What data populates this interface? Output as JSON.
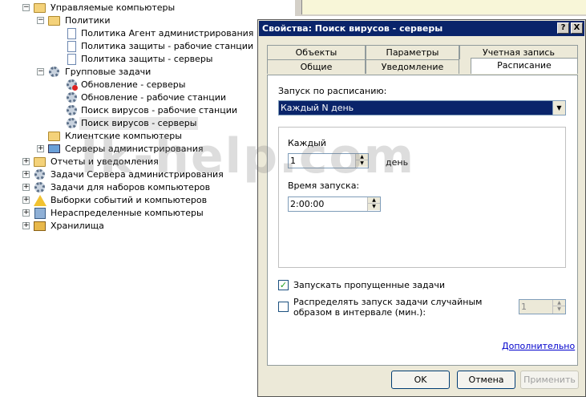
{
  "tree": {
    "managed_computers": "Управляемые компьютеры",
    "policies": "Политики",
    "policy_agent": "Политика Агент администрирования",
    "policy_workstations": "Политика защиты - рабочие станции",
    "policy_servers": "Политика защиты - серверы",
    "group_tasks": "Групповые задачи",
    "task_update_servers": "Обновление - серверы",
    "task_update_workstations": "Обновление - рабочие станции",
    "task_scan_workstations": "Поиск вирусов - рабочие станции",
    "task_scan_servers": "Поиск вирусов - серверы",
    "client_computers": "Клиентские компьютеры",
    "admin_servers": "Серверы администрирования",
    "reports": "Отчеты и уведомления",
    "admin_server_tasks": "Задачи Сервера администрирования",
    "computer_set_tasks": "Задачи для наборов компьютеров",
    "event_selections": "Выборки событий и компьютеров",
    "unassigned": "Нераспределенные компьютеры",
    "storages": "Хранилища"
  },
  "dialog": {
    "title": "Свойства: Поиск вирусов - серверы",
    "help_btn": "?",
    "close_btn": "X",
    "tabs_back": [
      "Объекты",
      "Параметры",
      "Учетная запись"
    ],
    "tabs_front": [
      "Общие",
      "Уведомление",
      "Расписание"
    ],
    "schedule_label": "Запуск по расписанию:",
    "schedule_value": "Каждый N день",
    "every_label": "Каждый",
    "every_value": "1",
    "every_unit": "день",
    "start_time_label": "Время запуска:",
    "start_time_value": "2:00:00",
    "run_missed_label": "Запускать пропущенные задачи",
    "run_missed_checked": true,
    "distribute_label": "Распределять запуск задачи случайным образом в интервале (мин.):",
    "distribute_checked": false,
    "distribute_value": "1",
    "advanced_link": "Дополнительно",
    "ok": "OK",
    "cancel": "Отмена",
    "apply": "Применить"
  },
  "watermark": "Ik-help.com"
}
